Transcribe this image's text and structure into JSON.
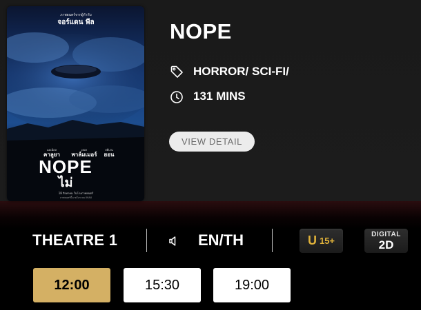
{
  "movie": {
    "title": "NOPE",
    "genre": "HORROR/ SCI-FI/",
    "duration": "131 MINS",
    "view_detail_label": "VIEW DETAIL",
    "poster": {
      "top_line_small": "ภาพยนตร์จากผู้กำกับ",
      "director": "จอร์แดน พีล",
      "cast": [
        "แดเนียล",
        "คาลูยา",
        "เคเค",
        "พาล์มเมอร์",
        "สตีเว่น",
        "ยอน"
      ],
      "title_en": "NOPE",
      "title_th": "ไม่",
      "release_line": "18 สิงหาคม ในโรงภาพยนตร์",
      "formats_line": "ภาพยนตร์นี้ฉายในระบบ IMAX"
    }
  },
  "session": {
    "theatre": "THEATRE 1",
    "language": "EN/TH",
    "rating_u": "U",
    "rating_age": "15+",
    "format_top": "DIGITAL",
    "format_bottom": "2D"
  },
  "showtimes": [
    {
      "time": "12:00",
      "selected": true
    },
    {
      "time": "15:30",
      "selected": false
    },
    {
      "time": "19:00",
      "selected": false
    }
  ],
  "icons": {
    "genre": "tag-icon",
    "duration": "clock-icon",
    "sound": "speaker-icon"
  },
  "colors": {
    "accent_gold": "#d4b064",
    "rating_gold": "#e0b23a",
    "card_bg": "#1c1c1c"
  }
}
